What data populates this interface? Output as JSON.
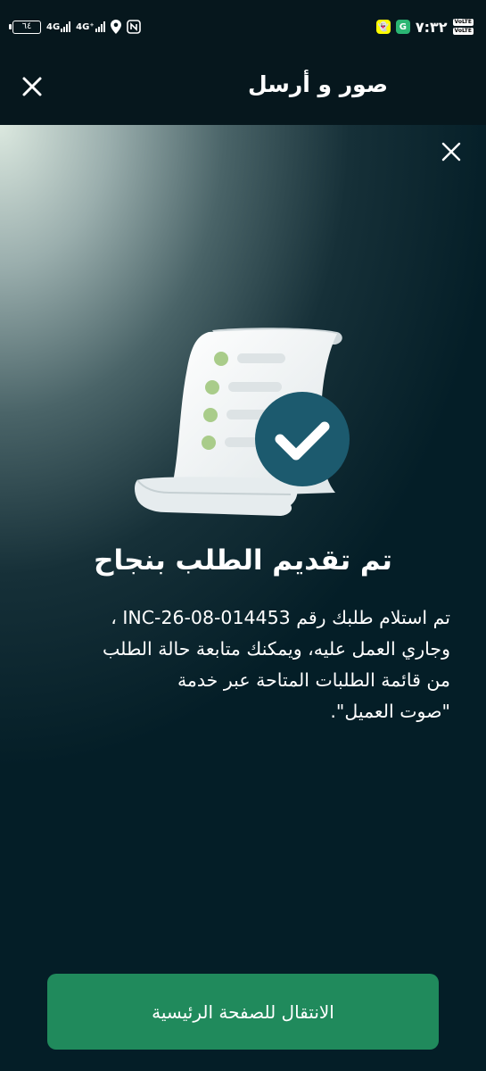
{
  "status_bar": {
    "battery": "٦٤",
    "network_1": "4G",
    "network_2": "4G⁺",
    "time": "٧:٣٢",
    "volte_1": "VoLTE",
    "volte_2": "VoLTE",
    "icons": [
      "battery-icon",
      "signal-icon",
      "signal-icon",
      "location-icon",
      "nfc-icon",
      "snapchat-icon",
      "app-icon"
    ]
  },
  "app_bar": {
    "title": "صور و أرسل",
    "close_icon": "close-icon"
  },
  "panel": {
    "close_icon": "close-icon",
    "illustration": "document-check-illustration",
    "title": "تم تقديم الطلب بنجاح",
    "message_lines": [
      "تم استلام طلبك رقم INC-26-08-014453 ،",
      "وجاري العمل عليه، ويمكنك متابعة حالة الطلب",
      "من قائمة الطلبات المتاحة عبر خدمة",
      "\"صوت العميل\"."
    ],
    "button_label": "الانتقال للصفحة الرئيسية"
  },
  "colors": {
    "app_bar_bg": "#06171d",
    "button_bg": "#208a5c",
    "check_circle": "#1c5a6e",
    "bullet_green": "#a9cc8a"
  }
}
